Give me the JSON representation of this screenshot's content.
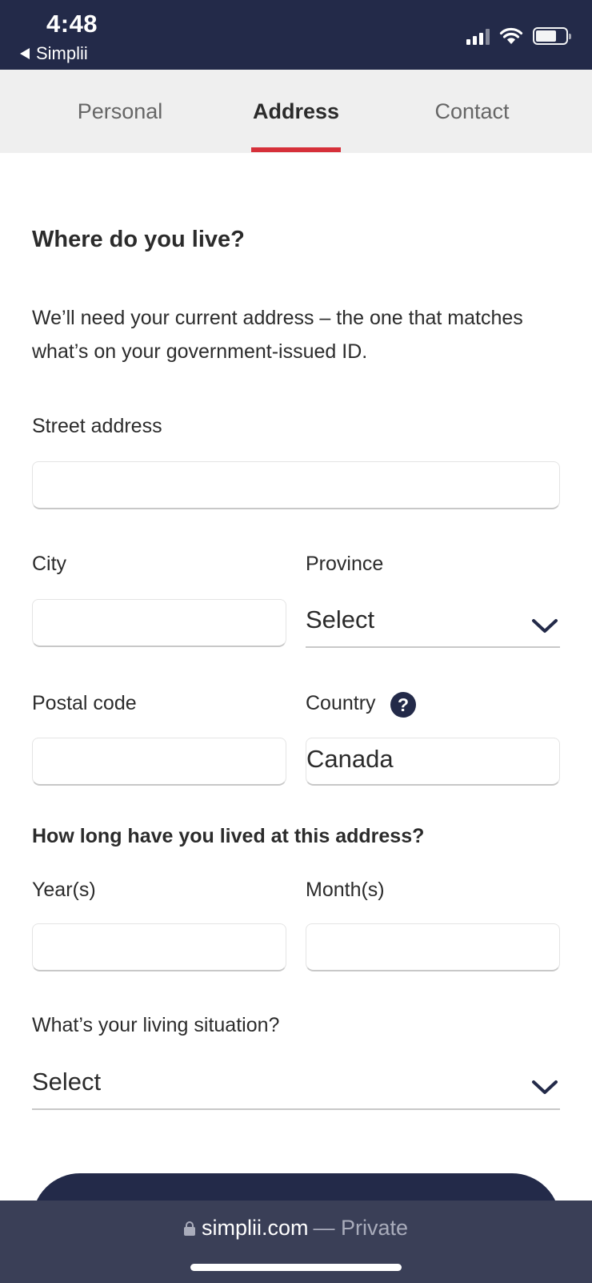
{
  "status_bar": {
    "time": "4:48",
    "back_app": "Simplii"
  },
  "tabs": [
    {
      "label": "Personal",
      "active": false
    },
    {
      "label": "Address",
      "active": true
    },
    {
      "label": "Contact",
      "active": false
    }
  ],
  "form": {
    "heading": "Where do you live?",
    "intro": "We’ll need your current address – the one that matches what’s on your government-issued ID.",
    "street_label": "Street address",
    "street_value": "",
    "city_label": "City",
    "city_value": "",
    "province_label": "Province",
    "province_value": "Select",
    "postal_label": "Postal code",
    "postal_value": "",
    "country_label": "Country",
    "country_value": "Canada",
    "duration_heading": "How long have you lived at this address?",
    "years_label": "Year(s)",
    "years_value": "",
    "months_label": "Month(s)",
    "months_value": "",
    "living_label": "What’s your living situation?",
    "living_value": "Select"
  },
  "browser": {
    "domain": "simplii.com",
    "mode": "— Private"
  },
  "colors": {
    "navy": "#232a49",
    "accent_red": "#d6303a",
    "tab_bg": "#efefef"
  },
  "icons": [
    "signal-icon",
    "wifi-icon",
    "battery-icon",
    "chevron-down-icon",
    "help-icon",
    "lock-icon"
  ]
}
